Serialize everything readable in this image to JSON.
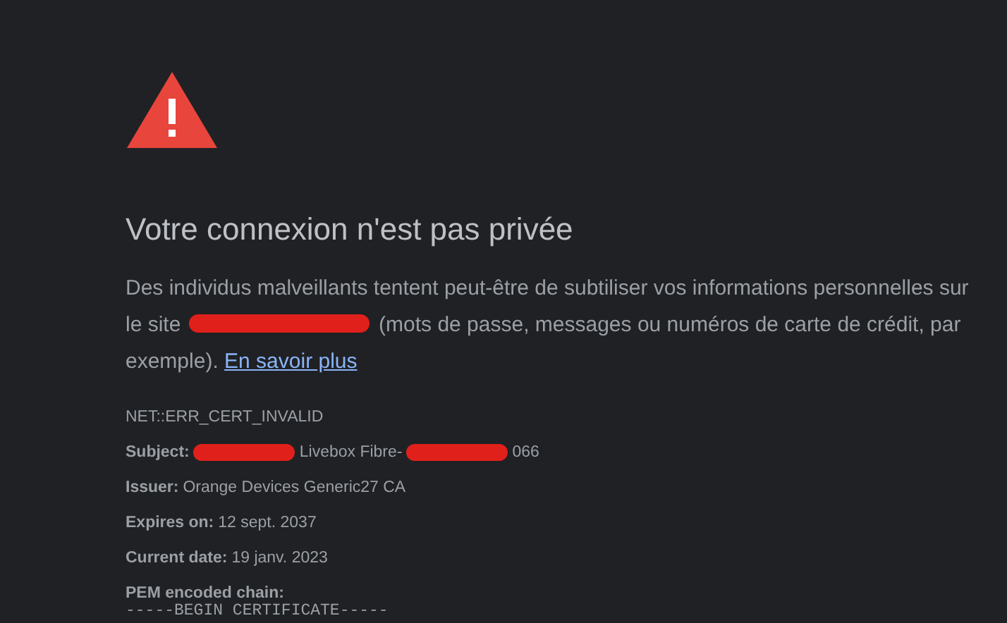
{
  "title": "Votre connexion n'est pas privée",
  "message": [
    {
      "kind": "text",
      "text": "Des individus malveillants tentent peut-être de subtiliser vos informations personnelles sur le site"
    },
    {
      "kind": "redaction"
    },
    {
      "kind": "text",
      "text": "(mots de passe, messages ou numéros de carte de crédit, par exemple)."
    },
    {
      "kind": "link",
      "text": "En savoir plus"
    }
  ],
  "error_code": "NET::ERR_CERT_INVALID",
  "details": [
    {
      "label": "Subject:",
      "segments": [
        {
          "kind": "redaction"
        },
        {
          "kind": "text",
          "text": "Livebox Fibre-"
        },
        {
          "kind": "redaction"
        },
        {
          "kind": "text",
          "text": "066"
        }
      ]
    },
    {
      "label": "Issuer:",
      "segments": [
        {
          "kind": "text",
          "text": "Orange Devices Generic27 CA"
        }
      ]
    },
    {
      "label": "Expires on:",
      "segments": [
        {
          "kind": "text",
          "text": "12 sept. 2037"
        }
      ]
    },
    {
      "label": "Current date:",
      "segments": [
        {
          "kind": "text",
          "text": "19 janv. 2023"
        }
      ]
    },
    {
      "label": "PEM encoded chain:"
    }
  ],
  "pem": "-----BEGIN CERTIFICATE-----"
}
